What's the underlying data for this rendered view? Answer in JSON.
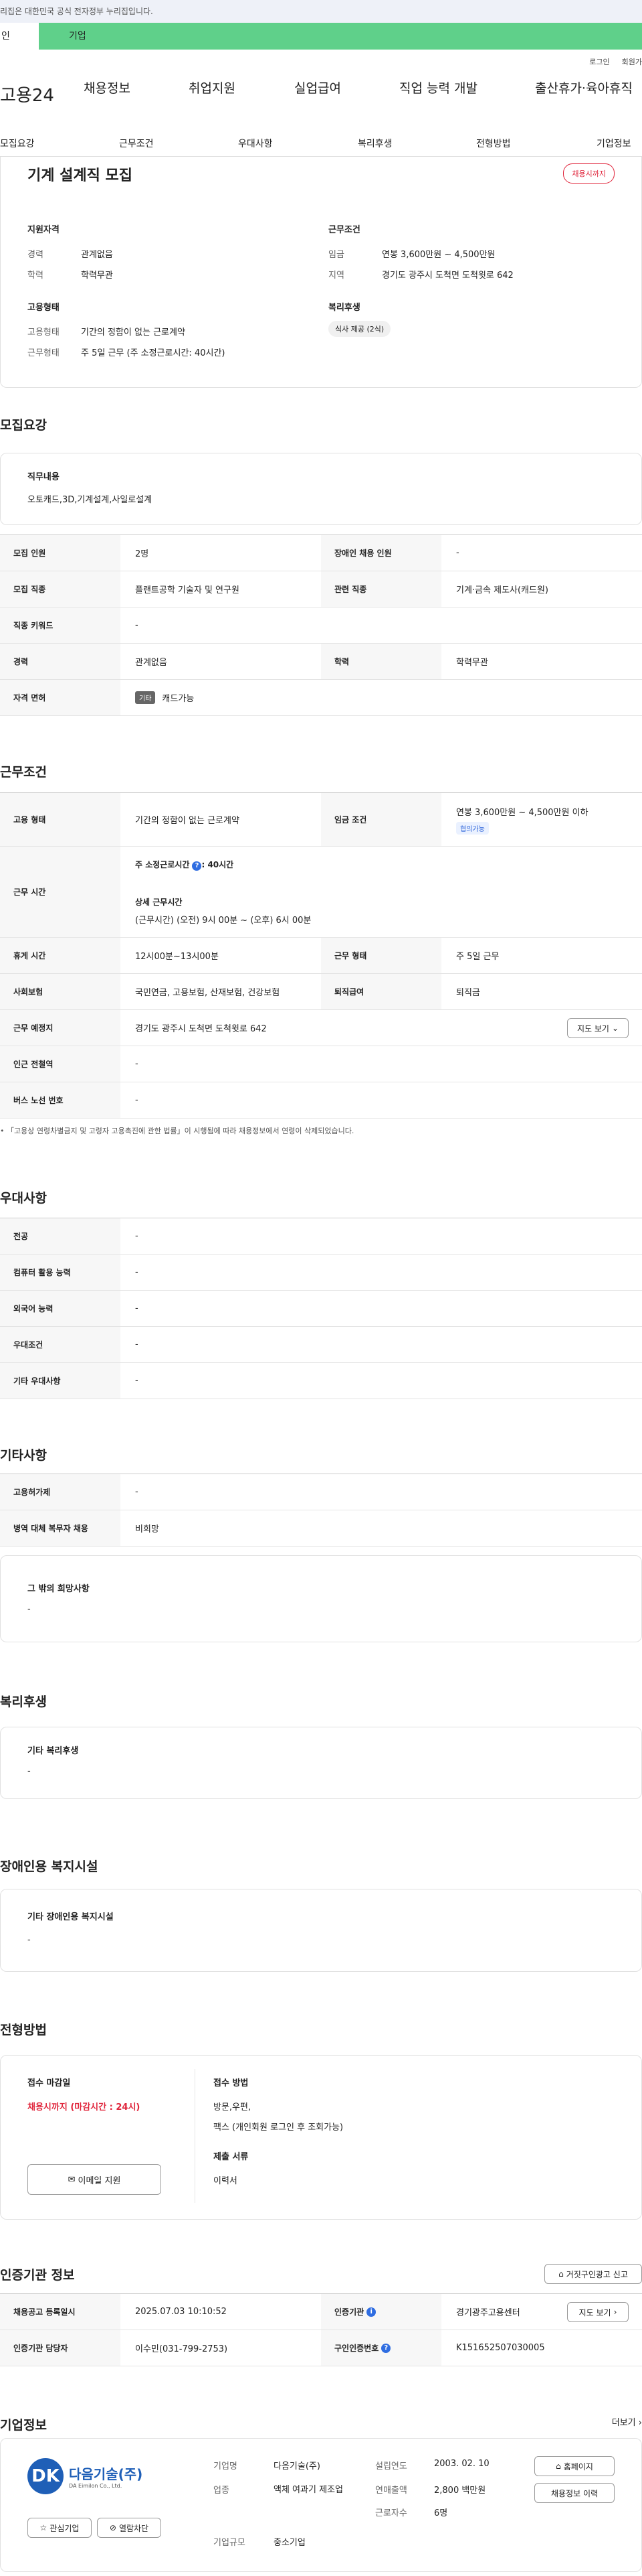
{
  "banner": {
    "text": "리집은 대한민국 공식 전자정부 누리집입니다."
  },
  "tabs": {
    "personal": "인",
    "company": "기업"
  },
  "util": {
    "login": "로그인",
    "join": "회원가"
  },
  "gnb": {
    "logo": "고용24",
    "items": [
      "채용정보",
      "취업지원",
      "실업급여",
      "직업 능력 개발",
      "출산휴가·육아휴직"
    ]
  },
  "subnav": {
    "items": [
      "모집요강",
      "근무조건",
      "우대사항",
      "복리후생",
      "전형방법",
      "기업정보"
    ]
  },
  "summary": {
    "title": "기계 설계직 모집",
    "status": "채용시까지",
    "qual_title": "지원자격",
    "qual": [
      {
        "k": "경력",
        "v": "관계없음"
      },
      {
        "k": "학력",
        "v": "학력무관"
      }
    ],
    "cond_title": "근무조건",
    "cond": [
      {
        "k": "임금",
        "v": "연봉 3,600만원 ~ 4,500만원"
      },
      {
        "k": "지역",
        "v": "경기도 광주시 도척면 도척윗로 642"
      }
    ],
    "emp_title": "고용형태",
    "emp": [
      {
        "k": "고용형태",
        "v": "기간의 정함이 없는 근로계약"
      },
      {
        "k": "근무형태",
        "v": "주 5일 근무 (주 소정근로시간: 40시간)"
      }
    ],
    "welfare_title": "복리후생",
    "welfare_chip": "식사 제공 (2식)"
  },
  "recruit": {
    "heading": "모집요강",
    "duty_title": "직무내용",
    "duty": "오토캐드,3D,기계설계,사일로설계",
    "rows": [
      {
        "th1": "모집 인원",
        "td1": "2명",
        "th2": "장애인 채용 인원",
        "td2": "-"
      },
      {
        "th1": "모집 직종",
        "td1": "플랜트공학 기술자 및 연구원",
        "th2": "관련 직종",
        "td2": "기계·금속 제도사(캐드원)"
      },
      {
        "th1": "직종 키워드",
        "td1": "-"
      },
      {
        "th1": "경력",
        "td1": "관계없음",
        "th2": "학력",
        "td2": "학력무관"
      },
      {
        "th1": "자격 면허",
        "badge": "기타",
        "td1": "캐드가능"
      }
    ]
  },
  "work": {
    "heading": "근무조건",
    "emp_type_th": "고용 형태",
    "emp_type": "기간의 정함이 없는 근로계약",
    "wage_th": "임금 조건",
    "wage": "연봉 3,600만원 ~ 4,500만원 이하",
    "wage_chip": "협의가능",
    "hours_th": "근무 시간",
    "hours_main": "주 소정근로시간",
    "hours_value": ": 40시간",
    "hours_detail_title": "상세 근무시간",
    "hours_detail": "(근무시간) (오전) 9시 00분 ~ (오후) 6시 00분",
    "break_th": "휴게 시간",
    "break": "12시00분~13시00분",
    "form_th": "근무 형태",
    "form": "주 5일 근무",
    "ins_th": "사회보험",
    "ins": "국민연금, 고용보험, 산재보험, 건강보험",
    "retire_th": "퇴직급여",
    "retire": "퇴직금",
    "place_th": "근무 예정지",
    "place": "경기도 광주시 도척면 도척윗로 642",
    "map_btn": "지도 보기",
    "subway_th": "인근 전철역",
    "subway": "-",
    "bus_th": "버스 노선 번호",
    "bus": "-",
    "note": "「고용상 연령차별금지 및 고령자 고용촉진에 관한 법률」이 시행됨에 따라 채용정보에서 연령이 삭제되었습니다."
  },
  "pref": {
    "heading": "우대사항",
    "rows": [
      {
        "th": "전공",
        "td": "-"
      },
      {
        "th": "컴퓨터 활용 능력",
        "td": "-"
      },
      {
        "th": "외국어 능력",
        "td": "-"
      },
      {
        "th": "우대조건",
        "td": "-"
      },
      {
        "th": "기타 우대사항",
        "td": "-"
      }
    ]
  },
  "etc": {
    "heading": "기타사항",
    "rows": [
      {
        "th": "고용허가제",
        "td": "-"
      },
      {
        "th": "병역 대체 복무자 채용",
        "td": "비희망"
      }
    ],
    "other_title": "그 밖의 희망사항",
    "other": "-"
  },
  "welfare": {
    "heading": "복리후생",
    "title": "기타 복리후생",
    "value": "-"
  },
  "disabled": {
    "heading": "장애인용 복지시설",
    "title": "기타 장애인용 복지시설",
    "value": "-"
  },
  "screen": {
    "heading": "전형방법",
    "deadline_title": "접수 마감일",
    "deadline": "채용시까지 (마감시간 : 24시)",
    "email_btn": "이메일 지원",
    "method_title": "접수 방법",
    "method1": "방문,우편,",
    "method2": "팩스 (개인회원 로그인 후 조회가능)",
    "docs_title": "제출 서류",
    "docs": "이력서"
  },
  "cert": {
    "heading": "인증기관 정보",
    "report_btn": "거짓구인광고 신고",
    "r1": {
      "th1": "채용공고 등록일시",
      "td1": "2025.07.03 10:10:52",
      "th2": "인증기관",
      "td2": "경기광주고용센터",
      "btn": "지도 보기"
    },
    "r2": {
      "th1": "인증기관 담당자",
      "td1": "이수민(031-799-2753)",
      "th2": "구인인증번호",
      "td2": "K151652507030005"
    }
  },
  "company": {
    "heading": "기업정보",
    "more": "더보기",
    "logo_name": "다음기술(주)",
    "logo_sub": "DA Eimilon Co., Ltd.",
    "interest_btn": "관심기업",
    "block_btn": "열람차단",
    "name_k": "기업명",
    "name_v": "다음기술(주)",
    "industry_k": "업종",
    "industry_v": "액체 여과기 제조업",
    "size_k": "기업규모",
    "size_v": "중소기업",
    "est_k": "설립연도",
    "est_v": "2003. 02. 10",
    "sales_k": "연매출액",
    "sales_v": "2,800 백만원",
    "staff_k": "근로자수",
    "staff_v": "6명",
    "home_btn": "홈페이지",
    "jobs_btn": "채용정보 이력"
  }
}
